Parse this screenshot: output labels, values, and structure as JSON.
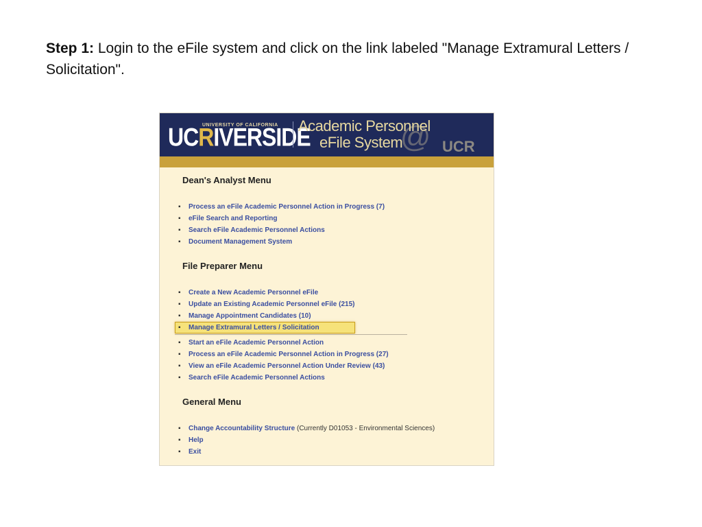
{
  "instruction": {
    "step_label": "Step 1:",
    "text": " Login to the eFile system and click on the link labeled \"Manage Extramural Letters / Solicitation\"."
  },
  "banner": {
    "university_small": "UNIVERSITY OF CALIFORNIA",
    "logo_uc": "UC",
    "logo_r": "R",
    "logo_rest": "IVERSIDE",
    "title_line1": "Academic Personnel",
    "title_line2": "eFile System",
    "watermark": "UCR"
  },
  "deans_menu": {
    "heading": "Dean's Analyst Menu",
    "items": [
      {
        "label": "Process an eFile Academic Personnel Action in Progress (7)"
      },
      {
        "label": "eFile Search and Reporting"
      },
      {
        "label": "Search eFile Academic Personnel Actions"
      },
      {
        "label": "Document Management System"
      }
    ]
  },
  "file_preparer_menu": {
    "heading": "File Preparer Menu",
    "items": [
      {
        "label": "Create a New Academic Personnel eFile"
      },
      {
        "label": "Update an Existing Academic Personnel eFile (215)"
      },
      {
        "label": "Manage Appointment Candidates (10)"
      },
      {
        "label": "Manage Extramural Letters / Solicitation",
        "highlighted": true
      }
    ],
    "items2": [
      {
        "label": "Start an eFile Academic Personnel Action"
      },
      {
        "label": "Process an eFile Academic Personnel Action in Progress (27)"
      },
      {
        "label": "View an eFile Academic Personnel Action Under Review (43)"
      },
      {
        "label": "Search eFile Academic Personnel Actions"
      }
    ]
  },
  "general_menu": {
    "heading": "General Menu",
    "items": [
      {
        "label": "Change Accountability Structure",
        "note": " (Currently D01053 - Environmental Sciences)"
      },
      {
        "label": "Help"
      },
      {
        "label": "Exit"
      }
    ]
  },
  "colors": {
    "banner": "#1f2a5a",
    "gold_bar": "#c9a13b",
    "panel_bg": "#fdf3d6",
    "link": "#3a4ea0",
    "highlight": "#f6e27a"
  }
}
